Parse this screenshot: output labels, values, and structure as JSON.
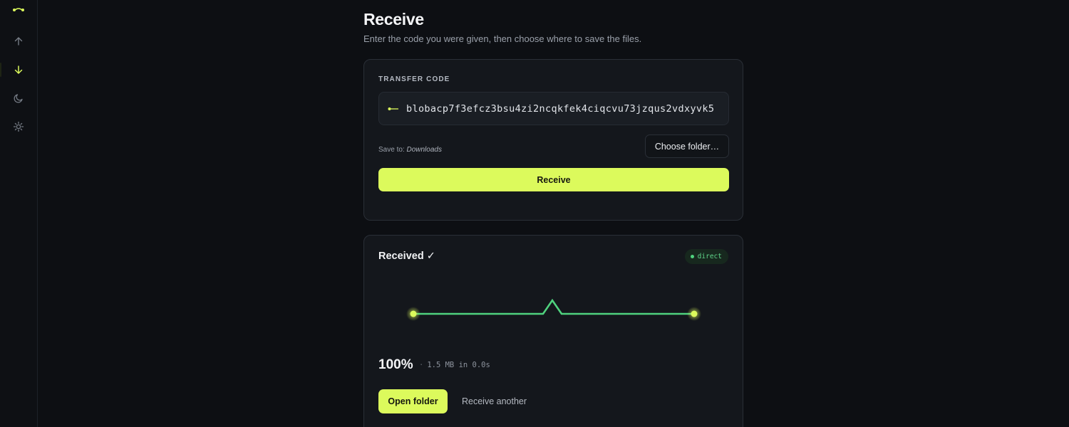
{
  "sidebar": {
    "logo_icon": "app-logo-icon",
    "items": [
      {
        "id": "send",
        "icon": "arrow-up-icon",
        "active": false
      },
      {
        "id": "receive",
        "icon": "arrow-down-icon",
        "active": true
      },
      {
        "id": "history",
        "icon": "moon-icon",
        "active": false
      },
      {
        "id": "settings",
        "icon": "sun-icon",
        "active": false
      }
    ]
  },
  "page": {
    "title": "Receive",
    "subtitle": "Enter the code you were given, then choose where to save the files."
  },
  "transfer": {
    "section_label": "TRANSFER CODE",
    "code_icon": "key-icon",
    "code_value": "blobacp7f3efcz3bsu4zi2ncqkfek4ciqcvu73jzqus2vdxyvk5",
    "save_to_label": "Save to:",
    "save_to_folder": "Downloads",
    "choose_folder_label": "Choose folder…",
    "receive_label": "Receive"
  },
  "result": {
    "title": "Received ✓",
    "badge_label": "direct",
    "progress_percent": 100,
    "percent_text": "100%",
    "stats_separator": "·",
    "stats_text": "1.5 MB in 0.0s",
    "open_folder_label": "Open folder",
    "receive_another_label": "Receive another"
  },
  "colors": {
    "accent": "#dcfa5c",
    "success": "#4fd27e",
    "background": "#0d0f13",
    "card": "#14171c"
  }
}
